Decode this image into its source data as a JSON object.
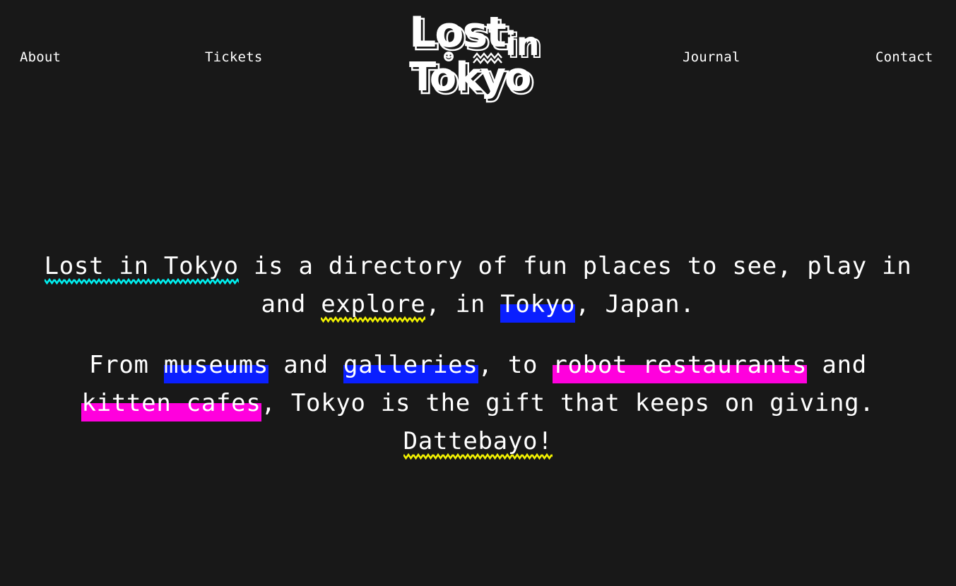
{
  "nav": {
    "about": "About",
    "tickets": "Tickets",
    "journal": "Journal",
    "contact": "Contact"
  },
  "logo": {
    "line1": "Lost",
    "line1_small": "in",
    "line2": "Tokyo"
  },
  "intro": {
    "p1": {
      "link_lost_in_tokyo": "Lost in Tokyo",
      "t1": " is a directory of fun places to see, play in and ",
      "link_explore": "explore",
      "t2": ", in ",
      "link_tokyo": "Tokyo",
      "t3": ", Japan."
    },
    "p2": {
      "t0": "From ",
      "link_museums": "museums",
      "t1": " and ",
      "link_galleries": "galleries",
      "t2": ", to ",
      "link_robot_restaurants": "robot restaurants",
      "t3": " and ",
      "link_kitten_cafes": "kitten cafes",
      "t4": ", Tokyo is the gift that keeps on giving. ",
      "link_dattebayo": "Dattebayo!"
    }
  },
  "colors": {
    "background": "#181818",
    "text": "#ffffff",
    "highlight_blue": "#0a1fff",
    "highlight_pink": "#ff00dd",
    "wave_cyan": "#00f0f0",
    "wave_yellow": "#f2f200"
  },
  "icons": {
    "logo_smiley": "smiley-face-icon",
    "logo_wave": "zigzag-wave-icon"
  }
}
